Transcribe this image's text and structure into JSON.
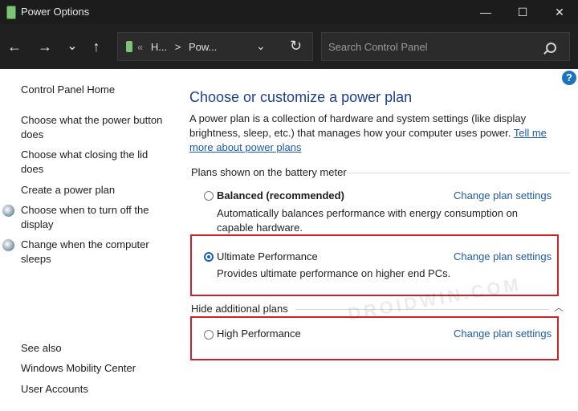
{
  "window": {
    "title": "Power Options"
  },
  "toolbar": {
    "back_glyph": "←",
    "forward_glyph": "→",
    "recent_glyph": "⌄",
    "up_glyph": "↑",
    "address_sep": "«",
    "crumb1": "H...",
    "crumb_arrow": ">",
    "crumb2": "Pow...",
    "address_dropdown_glyph": "⌄",
    "refresh_glyph": "↻",
    "search_placeholder": "Search Control Panel",
    "minimize_glyph": "—",
    "maximize_glyph": "☐",
    "close_glyph": "✕"
  },
  "sidebar": {
    "home": "Control Panel Home",
    "links": [
      "Choose what the power button does",
      "Choose what closing the lid does",
      "Create a power plan",
      "Choose when to turn off the display",
      "Change when the computer sleeps"
    ],
    "see_also_label": "See also",
    "see_also_links": [
      "Windows Mobility Center",
      "User Accounts"
    ]
  },
  "main": {
    "help_label": "?",
    "heading": "Choose or customize a power plan",
    "description": "A power plan is a collection of hardware and system settings (like display brightness, sleep, etc.) that manages how your computer uses power.",
    "tell_me_more": "Tell me more about power plans",
    "section_label": "Plans shown on the battery meter",
    "plans": [
      {
        "name": "Balanced (recommended)",
        "desc": "Automatically balances performance with energy consumption on capable hardware.",
        "selected": false
      },
      {
        "name": "Ultimate Performance",
        "desc": "Provides ultimate performance on higher end PCs.",
        "selected": true
      }
    ],
    "change_plan_label": "Change plan settings",
    "hide_additional": "Hide additional plans",
    "collapse_glyph": "︿",
    "additional_plans": [
      {
        "name": "High Performance",
        "selected": false
      }
    ],
    "watermark": "DROIDWIN.COM"
  },
  "colors": {
    "accent": "#1e5aa8",
    "highlight_box": "#d0202a",
    "heading": "#1e3f8f"
  }
}
